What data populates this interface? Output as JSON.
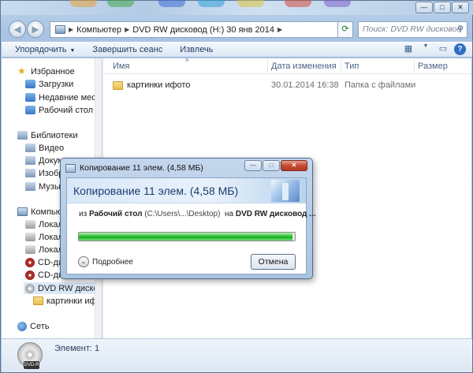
{
  "address": {
    "crumbs": [
      "Компьютер",
      "DVD RW дисковод (H:) 30 янв 2014"
    ],
    "search_placeholder": "Поиск: DVD RW дисковод ..."
  },
  "toolbar": {
    "organize": "Упорядочить",
    "burn": "Завершить сеанс",
    "eject": "Извлечь"
  },
  "sidebar": {
    "favorites": "Избранное",
    "downloads": "Загрузки",
    "recent": "Недавние места",
    "desktop": "Рабочий стол",
    "libraries": "Библиотеки",
    "video": "Видео",
    "documents": "Докум",
    "images": "Изобр",
    "music": "Музык",
    "computer": "Компьют",
    "local1": "Локал",
    "local2": "Локал",
    "local3": "Локал",
    "cd1": "CD-ди",
    "cd2": "CD-ди",
    "dvd": "DVD RW дисковод",
    "subfolder": "картинки ифото",
    "network": "Сеть"
  },
  "columns": {
    "name": "Имя",
    "date": "Дата изменения",
    "type": "Тип",
    "size": "Размер"
  },
  "files": [
    {
      "name": "картинки ифото",
      "date": "30.01.2014 16:38",
      "type": "Папка с файлами"
    }
  ],
  "details": {
    "count": "Элемент: 1",
    "disc_label": "DVD-R"
  },
  "dialog": {
    "title": "Копирование 11 элем. (4,58 МБ)",
    "heading": "Копирование 11 элем. (4,58 МБ)",
    "from_word": "из",
    "from_name": "Рабочий стол",
    "from_path": "(C:\\Users\\...\\Desktop)",
    "to_word": "на",
    "to_name": "DVD RW дисковод ...",
    "progress_percent": 99,
    "more": "Подробнее",
    "cancel": "Отмена"
  }
}
